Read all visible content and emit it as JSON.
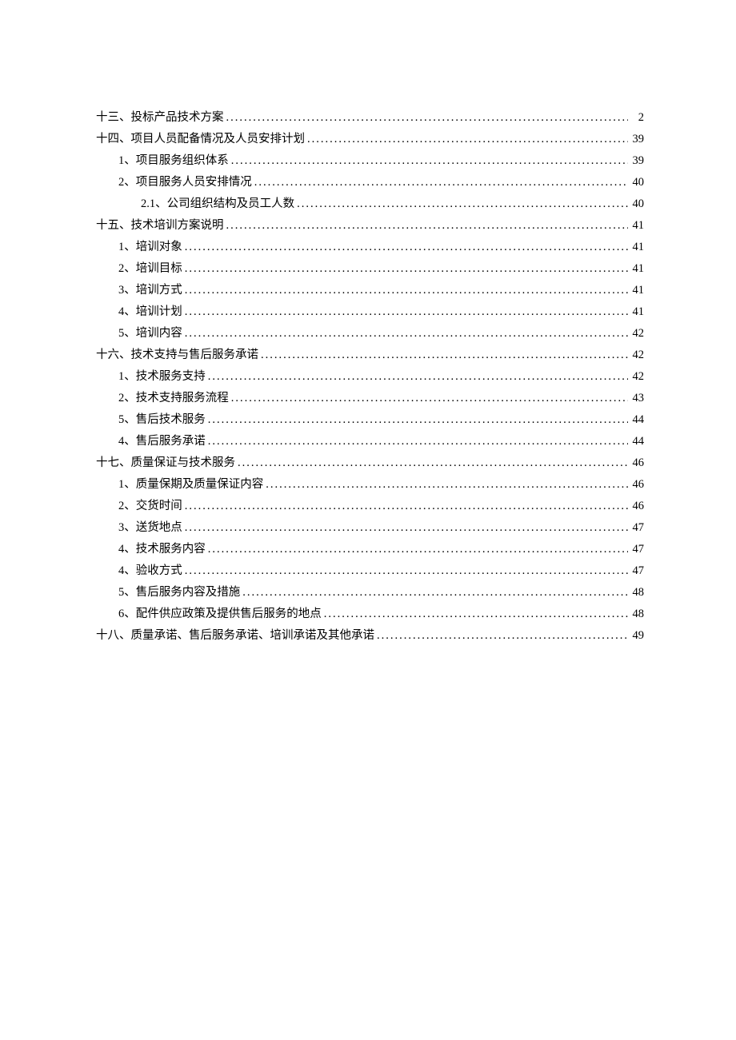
{
  "toc": [
    {
      "level": 0,
      "title": "十三、投标产品技术方案",
      "page": "2"
    },
    {
      "level": 0,
      "title": "十四、项目人员配备情况及人员安排计划",
      "page": "39"
    },
    {
      "level": 1,
      "title": "1、项目服务组织体系",
      "page": "39"
    },
    {
      "level": 1,
      "title": "2、项目服务人员安排情况",
      "page": "40"
    },
    {
      "level": 2,
      "title": "2.1、公司组织结构及员工人数",
      "page": "40"
    },
    {
      "level": 0,
      "title": "十五、技术培训方案说明",
      "page": "41"
    },
    {
      "level": 1,
      "title": "1、培训对象",
      "page": "41"
    },
    {
      "level": 1,
      "title": "2、培训目标",
      "page": "41"
    },
    {
      "level": 1,
      "title": "3、培训方式",
      "page": "41"
    },
    {
      "level": 1,
      "title": "4、培训计划",
      "page": "41"
    },
    {
      "level": 1,
      "title": "5、培训内容",
      "page": "42"
    },
    {
      "level": 0,
      "title": "十六、技术支持与售后服务承诺",
      "page": "42"
    },
    {
      "level": 1,
      "title": "1、技术服务支持",
      "page": "42"
    },
    {
      "level": 1,
      "title": "2、技术支持服务流程",
      "page": "43"
    },
    {
      "level": 1,
      "title": "5、售后技术服务",
      "page": "44"
    },
    {
      "level": 1,
      "title": "4、售后服务承诺",
      "page": "44"
    },
    {
      "level": 0,
      "title": "十七、质量保证与技术服务",
      "page": "46"
    },
    {
      "level": 1,
      "title": "1、质量保期及质量保证内容",
      "page": "46"
    },
    {
      "level": 1,
      "title": "2、交货时间",
      "page": "46"
    },
    {
      "level": 1,
      "title": "3、送货地点",
      "page": "47"
    },
    {
      "level": 1,
      "title": "4、技术服务内容",
      "page": "47"
    },
    {
      "level": 1,
      "title": "4、验收方式",
      "page": "47"
    },
    {
      "level": 1,
      "title": "5、售后服务内容及措施",
      "page": "48"
    },
    {
      "level": 1,
      "title": "6、配件供应政策及提供售后服务的地点",
      "page": "48"
    },
    {
      "level": 0,
      "title": "十八、质量承诺、售后服务承诺、培训承诺及其他承诺",
      "page": "49"
    }
  ]
}
